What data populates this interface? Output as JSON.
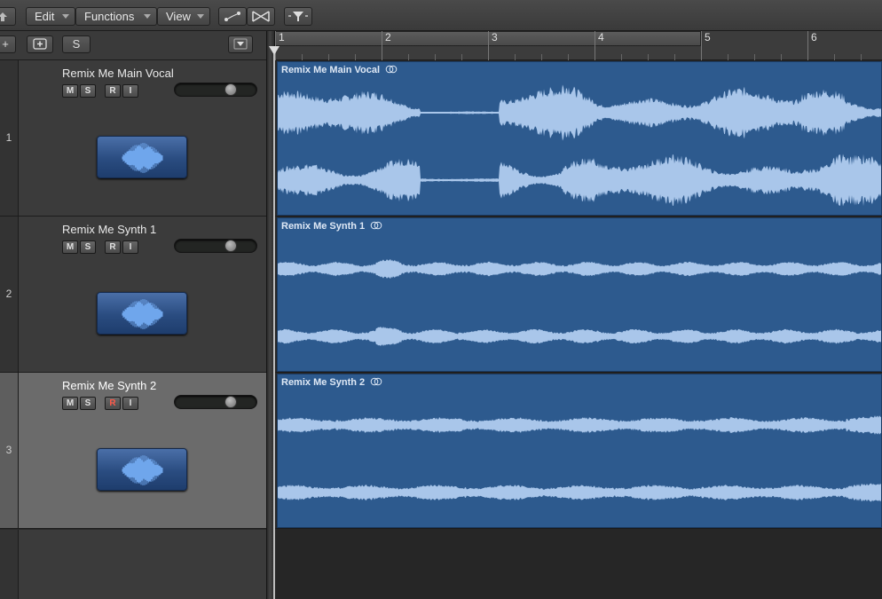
{
  "toolbar": {
    "menus": [
      {
        "label": "Edit"
      },
      {
        "label": "Functions"
      },
      {
        "label": "View"
      }
    ],
    "tools": [
      "automation-curve-icon",
      "crossfade-icon",
      "catch-filter-icon"
    ]
  },
  "header_controls": {
    "add_label": "+",
    "new_track_icon": "new-track-icon",
    "s_label": "S",
    "menu_icon": "chevron-down-icon"
  },
  "ruler": {
    "bars": [
      "1",
      "2",
      "3",
      "4",
      "5",
      "6"
    ],
    "cycle_from_bar": 1,
    "cycle_to_bar": 5
  },
  "tracks": [
    {
      "number": "1",
      "name": "Remix Me Main Vocal",
      "region": "Remix Me Main Vocal",
      "buttons": [
        "M",
        "S",
        "R",
        "I"
      ],
      "record_armed": false,
      "selected": false,
      "volume": 0.7,
      "wave_style": "vocal"
    },
    {
      "number": "2",
      "name": "Remix Me Synth 1",
      "region": "Remix Me Synth 1",
      "buttons": [
        "M",
        "S",
        "R",
        "I"
      ],
      "record_armed": false,
      "selected": false,
      "volume": 0.7,
      "wave_style": "synth"
    },
    {
      "number": "3",
      "name": "Remix Me Synth 2",
      "region": "Remix Me Synth 2",
      "buttons": [
        "M",
        "S",
        "R",
        "I"
      ],
      "record_armed": true,
      "selected": true,
      "volume": 0.7,
      "wave_style": "synth2"
    }
  ],
  "colors": {
    "region": "#2d5a8e",
    "waveform": "#a9c6ea",
    "record_armed": "#ff5a4a"
  }
}
